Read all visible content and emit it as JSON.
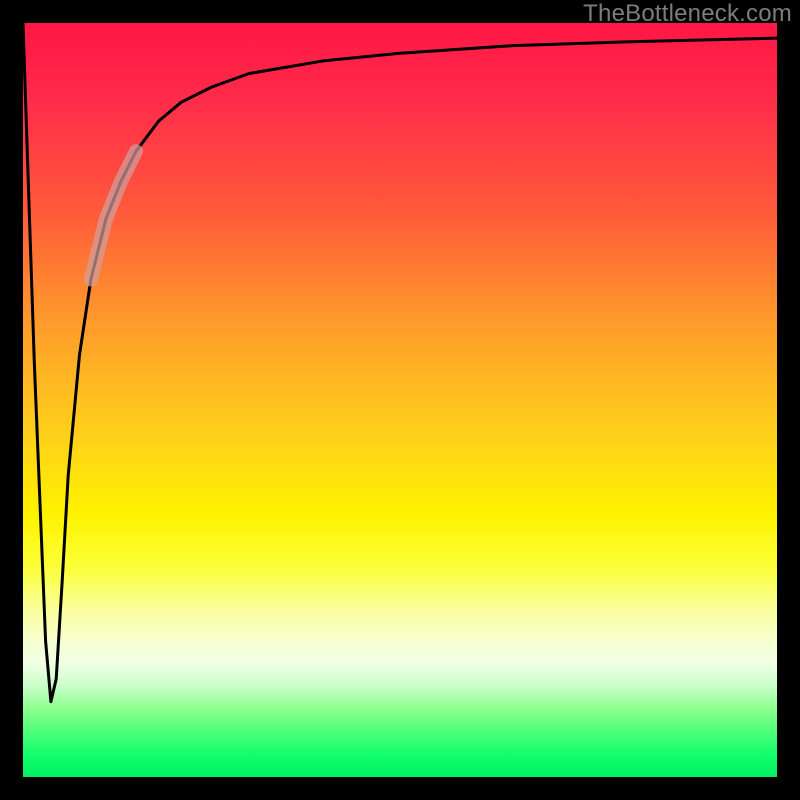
{
  "watermark": "TheBottleneck.com",
  "chart_data": {
    "type": "line",
    "title": "",
    "xlabel": "",
    "ylabel": "",
    "note": "Axes are unlabeled; values expressed as fraction of plot extent (0–1 on each axis). y=0 at bottom, y=1 at top.",
    "xlim": [
      0,
      1
    ],
    "ylim": [
      0,
      1
    ],
    "series": [
      {
        "name": "curve",
        "x": [
          0.0,
          0.015,
          0.03,
          0.037,
          0.044,
          0.052,
          0.06,
          0.075,
          0.09,
          0.11,
          0.13,
          0.15,
          0.18,
          0.21,
          0.25,
          0.3,
          0.4,
          0.5,
          0.65,
          0.8,
          1.0
        ],
        "y": [
          1.0,
          0.55,
          0.18,
          0.1,
          0.13,
          0.26,
          0.4,
          0.56,
          0.66,
          0.74,
          0.79,
          0.83,
          0.87,
          0.895,
          0.915,
          0.933,
          0.95,
          0.96,
          0.97,
          0.975,
          0.98
        ]
      }
    ],
    "highlight_segment": {
      "series": "curve",
      "x_from": 0.09,
      "x_to": 0.15,
      "note": "translucent pale band overlaid on the rising part of the curve"
    },
    "background_gradient": {
      "orientation": "vertical",
      "stops": [
        {
          "y": 1.0,
          "color": "#ff1744"
        },
        {
          "y": 0.6,
          "color": "#ff8a2a"
        },
        {
          "y": 0.35,
          "color": "#fff200"
        },
        {
          "y": 0.18,
          "color": "#faffb0"
        },
        {
          "y": 0.05,
          "color": "#50ff80"
        },
        {
          "y": 0.0,
          "color": "#00f060"
        }
      ]
    }
  }
}
